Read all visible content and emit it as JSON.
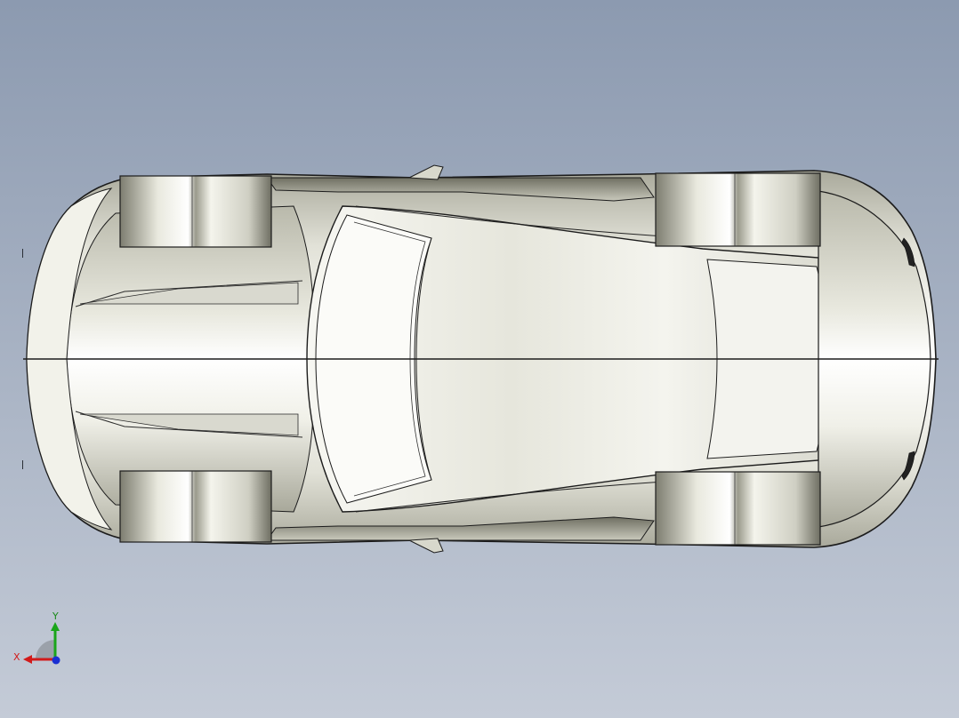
{
  "view": {
    "orientation": "top",
    "background": {
      "top": "#8c9ab0",
      "bottom": "#c4cbd7"
    }
  },
  "model": {
    "body_color": "#e9e9e0",
    "shadow_color": "#8c8c7e",
    "edge_color": "#1c1c1c"
  },
  "triad": {
    "x_label": "X",
    "y_label": "Y",
    "colors": {
      "x": "#d21a1a",
      "y": "#1aa51a",
      "z": "#1a2fd2"
    }
  }
}
